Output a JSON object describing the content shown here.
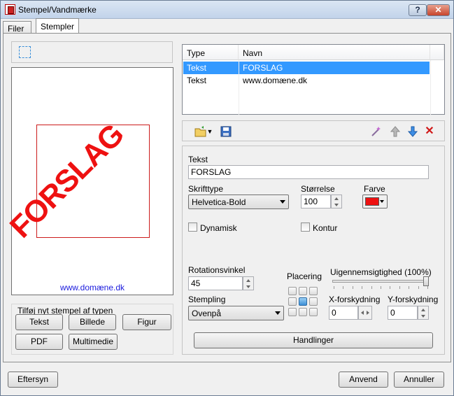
{
  "window": {
    "title": "Stempel/Vandmærke",
    "help_label": "?",
    "close_label": "✕"
  },
  "tabs": [
    {
      "label": "Filer"
    },
    {
      "label": "Stempler"
    }
  ],
  "left_toolbar": {
    "icon": "select-frame-icon"
  },
  "preview": {
    "stamp_text": "FORSLAG",
    "footer_text": "www.domæne.dk",
    "stamp_color": "#ee1111",
    "footer_color": "#1a1add"
  },
  "add_group": {
    "title": "Tilføj nyt stempel af typen",
    "buttons": [
      "Tekst",
      "Billede",
      "Figur",
      "PDF",
      "Multimedie"
    ]
  },
  "stamp_table": {
    "headers": [
      "Type",
      "Navn"
    ],
    "rows": [
      {
        "type": "Tekst",
        "name": "FORSLAG",
        "selected": true
      },
      {
        "type": "Tekst",
        "name": "www.domæne.dk",
        "selected": false
      }
    ]
  },
  "table_toolbar": {
    "icons": [
      "open-folder-icon",
      "dropdown-arrow-icon",
      "save-icon",
      "wand-icon",
      "move-up-icon",
      "move-down-icon",
      "delete-icon"
    ]
  },
  "props": {
    "text_label": "Tekst",
    "text_value": "FORSLAG",
    "font_label": "Skrifttype",
    "font_value": "Helvetica-Bold",
    "size_label": "Størrelse",
    "size_value": "100",
    "color_label": "Farve",
    "color_value": "#ee1111",
    "dynamic_label": "Dynamisk",
    "contour_label": "Kontur",
    "rotation_label": "Rotationsvinkel",
    "rotation_value": "45",
    "placement_label": "Placering",
    "opacity_label": "Uigennemsigtighed (100%)",
    "opacity_value": 1.0,
    "stamping_label": "Stempling",
    "stamping_value": "Ovenpå",
    "x_offset_label": "X-forskydning",
    "x_offset_value": "0",
    "y_offset_label": "Y-forskydning",
    "y_offset_value": "0",
    "actions_label": "Handlinger"
  },
  "footer_buttons": {
    "preview": "Eftersyn",
    "apply": "Anvend",
    "cancel": "Annuller"
  }
}
